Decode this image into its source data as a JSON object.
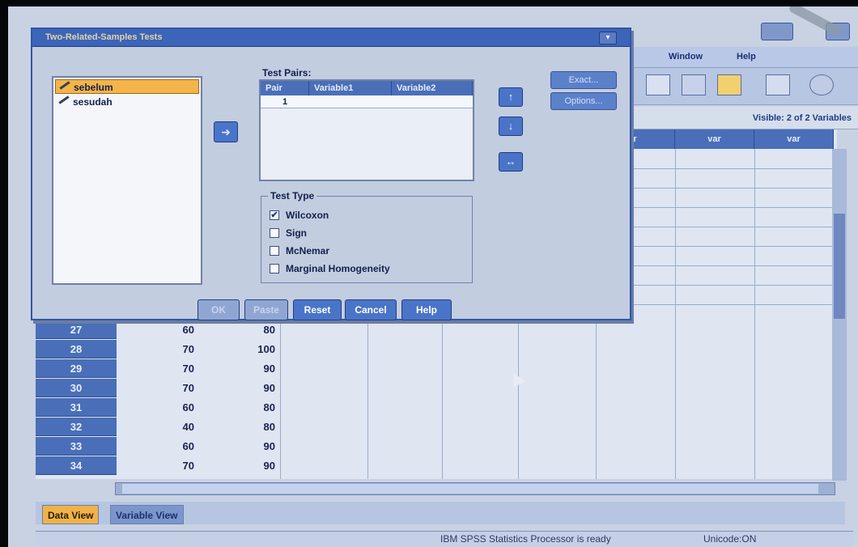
{
  "main_window": {
    "menu": [
      {
        "label": "Window"
      },
      {
        "label": "Help"
      }
    ],
    "visible_vars": "Visible: 2 of 2 Variables",
    "column_headers": {
      "partial": "r",
      "var1": "var",
      "var2": "var"
    },
    "rows": [
      {
        "num": "27",
        "sebelum": "60",
        "sesudah": "80"
      },
      {
        "num": "28",
        "sebelum": "70",
        "sesudah": "100"
      },
      {
        "num": "29",
        "sebelum": "70",
        "sesudah": "90"
      },
      {
        "num": "30",
        "sebelum": "70",
        "sesudah": "90"
      },
      {
        "num": "31",
        "sebelum": "60",
        "sesudah": "80"
      },
      {
        "num": "32",
        "sebelum": "40",
        "sesudah": "80"
      },
      {
        "num": "33",
        "sebelum": "60",
        "sesudah": "90"
      },
      {
        "num": "34",
        "sebelum": "70",
        "sesudah": "90"
      }
    ],
    "tabs": [
      {
        "label": "Data View"
      },
      {
        "label": "Variable View"
      }
    ],
    "status": "IBM SPSS Statistics Processor is ready",
    "unicode": "Unicode:ON"
  },
  "dialog": {
    "title": "Two-Related-Samples Tests",
    "variables": [
      {
        "label": "sebelum",
        "selected": true
      },
      {
        "label": "sesudah",
        "selected": false
      }
    ],
    "test_pairs_label": "Test Pairs:",
    "pairs_table": {
      "headers": [
        "Pair",
        "Variable1",
        "Variable2"
      ],
      "rows": [
        {
          "pair": "1",
          "variable1": "",
          "variable2": ""
        }
      ]
    },
    "side_buttons": {
      "exact": "Exact...",
      "options": "Options..."
    },
    "test_type": {
      "legend": "Test Type",
      "options": [
        {
          "label": "Wilcoxon",
          "checked": true
        },
        {
          "label": "Sign",
          "checked": false
        },
        {
          "label": "McNemar",
          "checked": false
        },
        {
          "label": "Marginal Homogeneity",
          "checked": false
        }
      ]
    },
    "buttons": {
      "ok": "OK",
      "paste": "Paste",
      "reset": "Reset",
      "cancel": "Cancel",
      "help": "Help"
    },
    "icons": {
      "move": "arrow-right-icon",
      "up": "arrow-up-icon",
      "down": "arrow-down-icon",
      "swap": "swap-icon"
    }
  }
}
